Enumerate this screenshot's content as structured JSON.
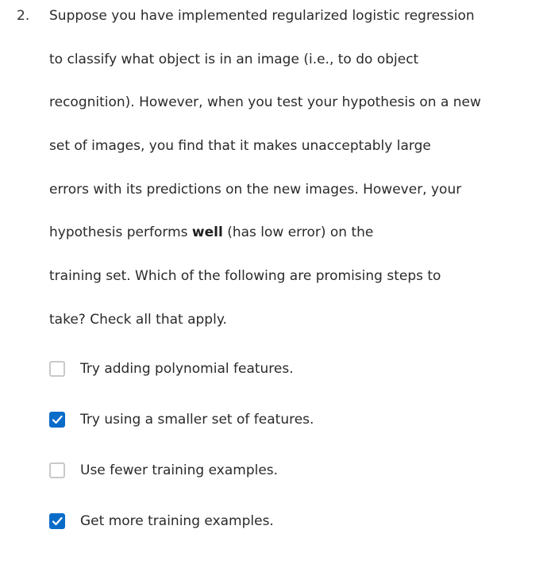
{
  "question": {
    "number": "2.",
    "lines": [
      {
        "text": "Suppose you have implemented regularized logistic regression"
      },
      {
        "text": "to classify what object is in an image (i.e., to do object"
      },
      {
        "text": "recognition). However, when you test your hypothesis on a new"
      },
      {
        "text": "set of images, you find that it makes unacceptably large"
      },
      {
        "text": "errors with its predictions on the new images. However, your"
      },
      {
        "before": "hypothesis performs ",
        "bold": "well",
        "after": " (has low error) on the"
      },
      {
        "text": "training set. Which of the following are promising steps to"
      },
      {
        "text": "take? Check all that apply."
      }
    ]
  },
  "options": [
    {
      "label": "Try adding polynomial features.",
      "checked": false
    },
    {
      "label": "Try using a smaller set of features.",
      "checked": true
    },
    {
      "label": "Use fewer training examples.",
      "checked": false
    },
    {
      "label": "Get more training examples.",
      "checked": true
    }
  ],
  "colors": {
    "checkbox_checked": "#0a6cc9",
    "checkbox_unchecked_border": "#c9c9c9",
    "text": "#2a2a2a"
  }
}
